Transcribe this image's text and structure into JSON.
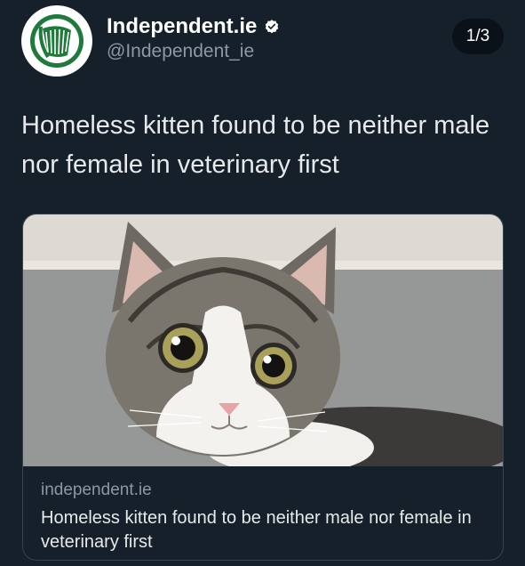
{
  "tweet": {
    "display_name": "Independent.ie",
    "handle": "@Independent_ie",
    "page_counter": "1/3",
    "text": "Homeless kitten found to be neither male nor female in veterinary first"
  },
  "link_card": {
    "domain": "independent.ie",
    "title": "Homeless kitten found to be neither male nor female in veterinary first"
  },
  "colors": {
    "background": "#15202b",
    "logo_green": "#1f7a3c",
    "verified_badge": "#ffffff"
  },
  "icons": {
    "avatar": "harp-logo-icon",
    "verified": "verified-badge-icon"
  }
}
